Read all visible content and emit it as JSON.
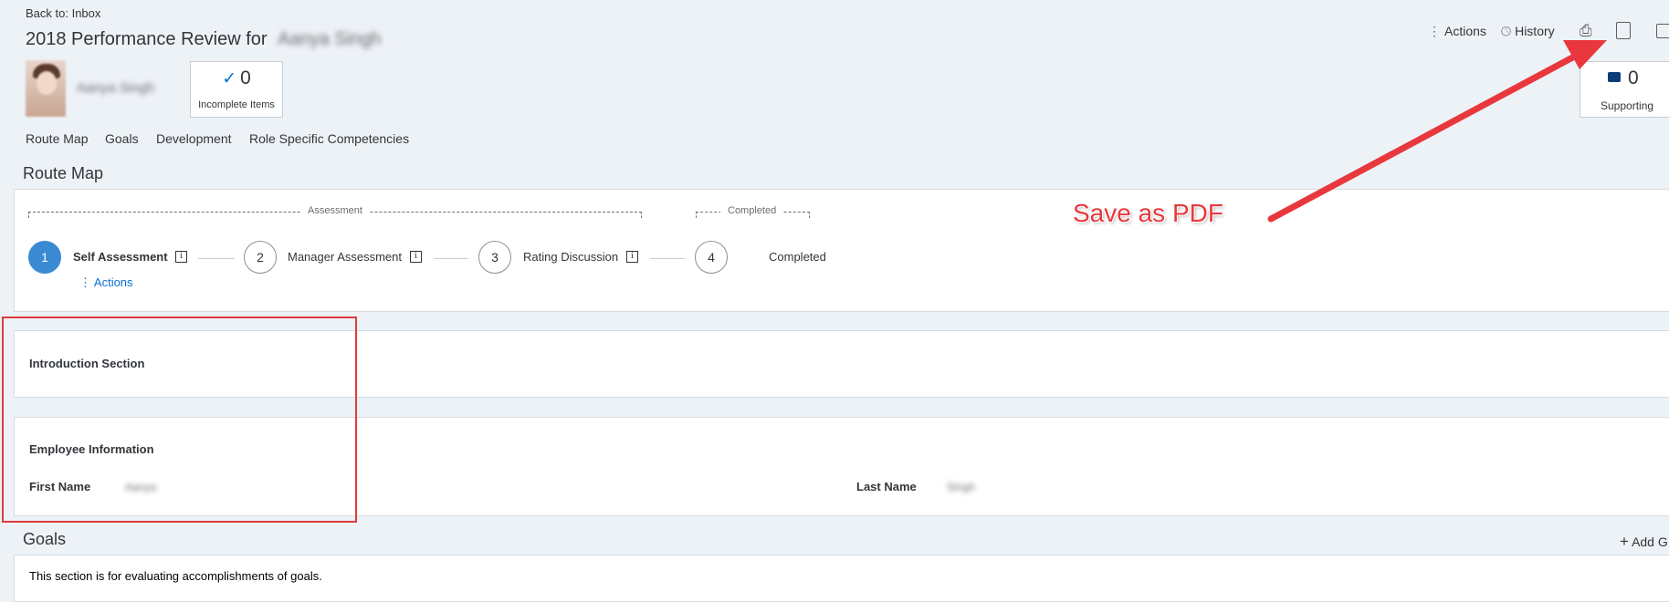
{
  "header": {
    "back_link": "Back to: Inbox",
    "title_prefix": "2018 Performance Review for",
    "title_name_blurred": "Aanya Singh",
    "employee_name_blurred": "Aanya Singh"
  },
  "tiles": {
    "incomplete": {
      "count": "0",
      "label": "Incomplete Items"
    },
    "supporting": {
      "count": "0",
      "label": "Supporting"
    }
  },
  "toolbar": {
    "actions_label": "Actions",
    "history_label": "History",
    "icons": [
      "print-icon",
      "export-pdf-icon",
      "save-icon"
    ]
  },
  "tabs": [
    "Route Map",
    "Goals",
    "Development",
    "Role Specific Competencies"
  ],
  "route_map": {
    "title": "Route Map",
    "phases": {
      "assessment": "Assessment",
      "completed": "Completed"
    },
    "steps": [
      {
        "number": "1",
        "label": "Self Assessment"
      },
      {
        "number": "2",
        "label": "Manager Assessment"
      },
      {
        "number": "3",
        "label": "Rating Discussion"
      },
      {
        "number": "4",
        "label": "Completed"
      }
    ],
    "actions_link": "Actions"
  },
  "sections": {
    "introduction": "Introduction Section",
    "employee_info": {
      "title": "Employee Information",
      "first_name_label": "First Name",
      "first_name_value_blurred": "Aanya",
      "last_name_label": "Last Name",
      "last_name_value_blurred": "Singh"
    }
  },
  "goals": {
    "title": "Goals",
    "add_label": "Add G",
    "description": "This section is for evaluating accomplishments of goals."
  },
  "annotation": {
    "text": "Save as PDF",
    "color": "#e8383d"
  },
  "colors": {
    "accent": "#0a6ed1",
    "active_step": "#3a8ad3",
    "annotation_red": "#e03b3b"
  }
}
